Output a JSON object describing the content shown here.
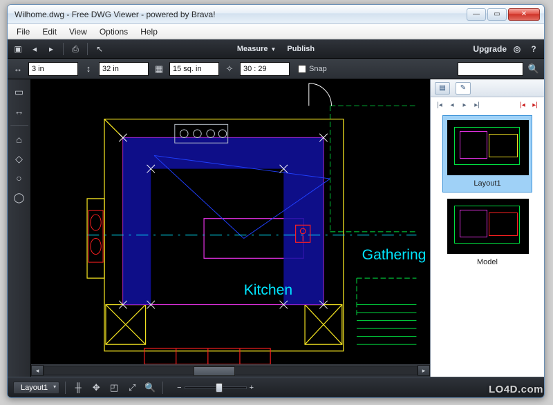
{
  "window": {
    "title": "Wilhome.dwg - Free DWG Viewer - powered by Brava!"
  },
  "menubar": {
    "items": [
      "File",
      "Edit",
      "View",
      "Options",
      "Help"
    ]
  },
  "appbar": {
    "center": {
      "measure_label": "Measure",
      "publish_label": "Publish"
    },
    "right": {
      "upgrade_label": "Upgrade"
    }
  },
  "measurebar": {
    "width_value": "3 in",
    "height_value": "32 in",
    "area_value": "15 sq. in",
    "time_value": "30 : 29",
    "snap_label": "Snap",
    "search_value": ""
  },
  "canvas": {
    "room1_label": "Kitchen",
    "room2_label": "Gathering"
  },
  "thumbs": {
    "layout1_label": "Layout1",
    "model_label": "Model"
  },
  "statusbar": {
    "tab_label": "Layout1"
  },
  "watermark": "LO4D.com"
}
